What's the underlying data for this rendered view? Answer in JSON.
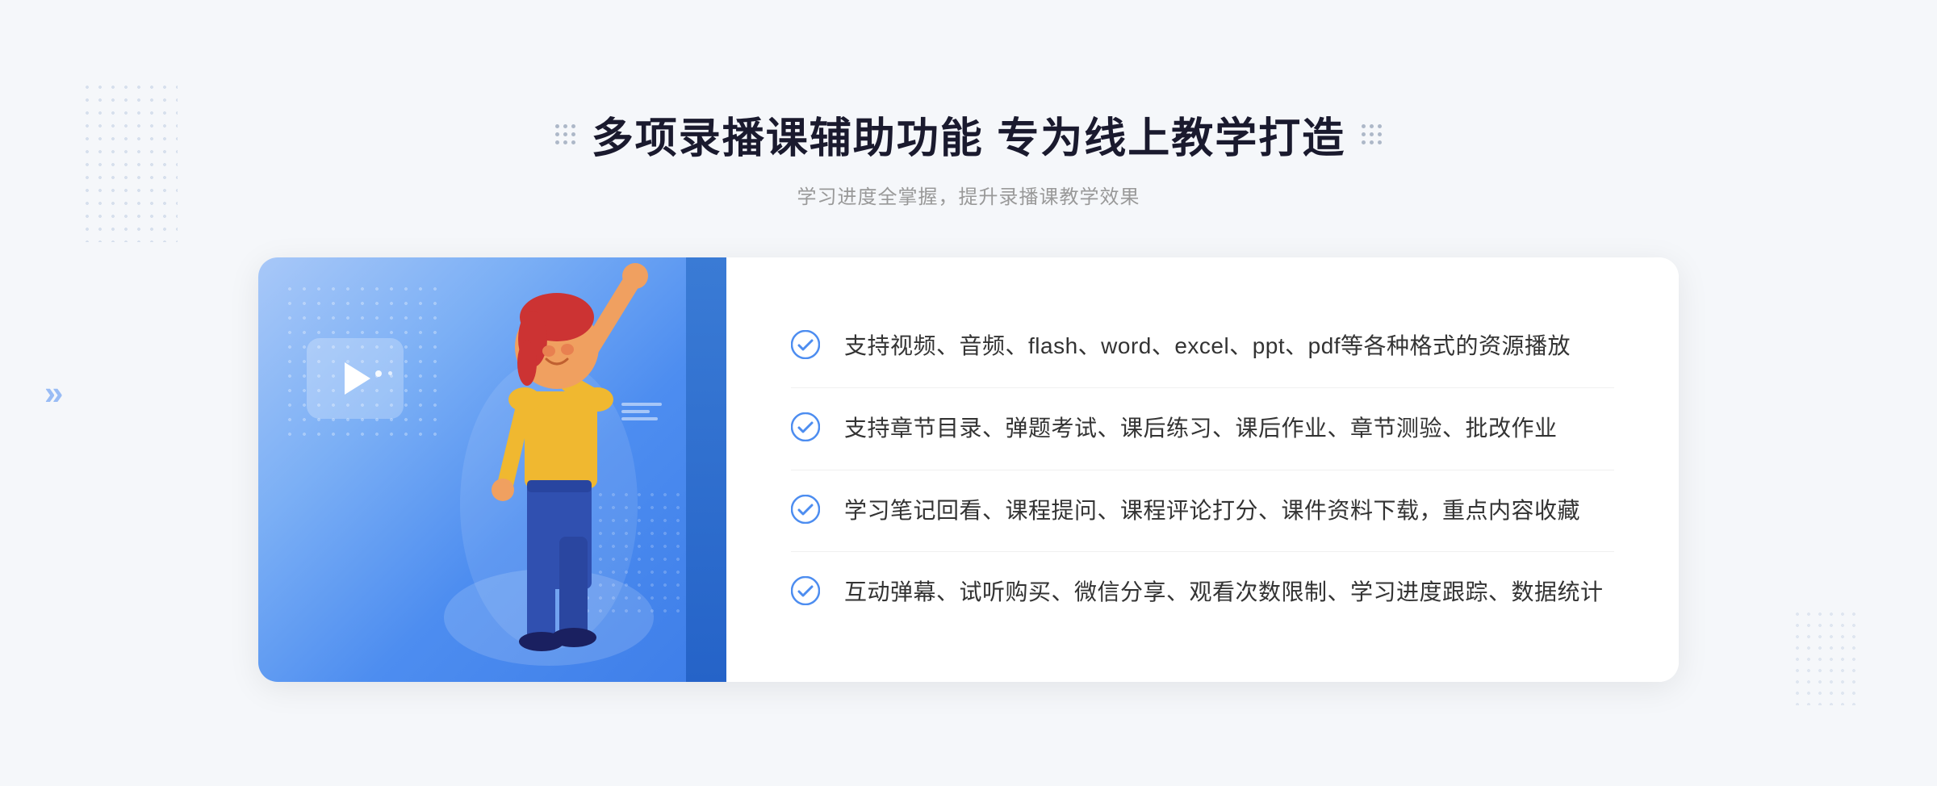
{
  "header": {
    "title": "多项录播课辅助功能 专为线上教学打造",
    "subtitle": "学习进度全掌握，提升录播课教学效果"
  },
  "features": [
    {
      "id": 1,
      "text": "支持视频、音频、flash、word、excel、ppt、pdf等各种格式的资源播放"
    },
    {
      "id": 2,
      "text": "支持章节目录、弹题考试、课后练习、课后作业、章节测验、批改作业"
    },
    {
      "id": 3,
      "text": "学习笔记回看、课程提问、课程评论打分、课件资料下载，重点内容收藏"
    },
    {
      "id": 4,
      "text": "互动弹幕、试听购买、微信分享、观看次数限制、学习进度跟踪、数据统计"
    }
  ],
  "icons": {
    "check": "✓",
    "play": "▶",
    "chevron_left": "«"
  },
  "colors": {
    "accent_blue": "#3d7de8",
    "light_blue": "#a8c8f8",
    "text_dark": "#1a1a2e",
    "text_gray": "#999999",
    "text_feature": "#333333",
    "check_color": "#4d8df0"
  }
}
